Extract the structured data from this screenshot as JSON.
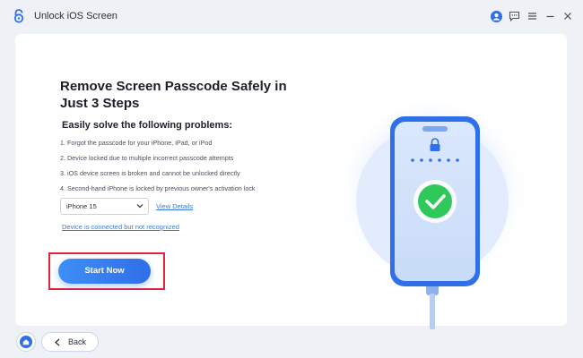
{
  "window": {
    "title": "Unlock iOS Screen",
    "controls": [
      "user-icon",
      "feedback-icon",
      "menu-icon",
      "minimize-icon",
      "close-icon"
    ]
  },
  "main": {
    "heading": "Remove Screen Passcode Safely in Just 3 Steps",
    "subheading": "Easily solve the following problems:",
    "problems": [
      "1. Forgot the passcode for your iPhone, iPad, or iPod",
      "2. Device locked due to multiple incorrect passcode attempts",
      "3. iOS device screen is broken and cannot be unlocked directly",
      "4. Second-hand iPhone is locked by previous owner's activation lock"
    ],
    "device_select": {
      "value": "iPhone 15"
    },
    "view_details": "View Details",
    "device_link": "Device is connected but not recognized",
    "start_button": "Start Now"
  },
  "footer": {
    "back_label": "Back"
  },
  "colors": {
    "accent": "#2f6fe8",
    "link": "#3a7bd5",
    "highlight": "#e0243a",
    "success": "#2fc95b",
    "background": "#eef1f6"
  }
}
